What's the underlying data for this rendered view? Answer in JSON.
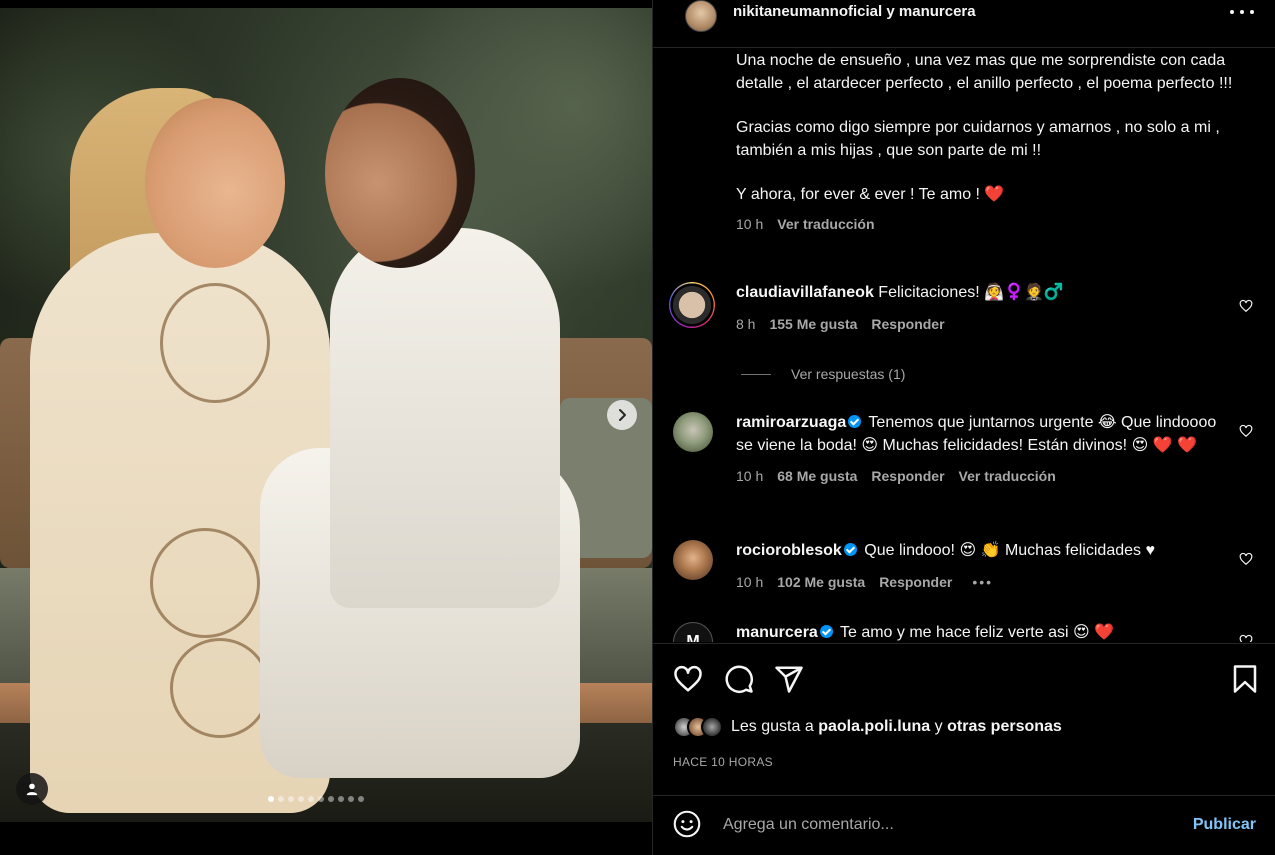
{
  "post": {
    "author": "nikitaneumannoficial",
    "connector": "y",
    "collaborator": "manurcera"
  },
  "caption": {
    "p1": "Una noche de ensueño , una vez mas que me sorprendiste con cada detalle , el atardecer perfecto , el anillo perfecto , el poema perfecto !!!",
    "p2": "Gracias como digo siempre por cuidarnos y amarnos , no solo a mi , también a mis hijas , que son parte de mi !!",
    "p3": "Y ahora, for ever & ever ! Te amo ! ❤️",
    "time": "10 h",
    "translate": "Ver traducción"
  },
  "comments": [
    {
      "user": "claudiavillafaneok",
      "text": "Felicitaciones! 👰♀️🤵♂️",
      "time": "8 h",
      "likes": "155 Me gusta",
      "reply": "Responder",
      "verified": false
    },
    {
      "user": "ramiroarzuaga",
      "text": "Tenemos que juntarnos urgente 😂 Que lindoooo se viene la boda! 😍 Muchas felicidades! Están divinos! 😍 ❤️ ❤️",
      "time": "10 h",
      "likes": "68 Me gusta",
      "reply": "Responder",
      "translate": "Ver traducción",
      "verified": true
    },
    {
      "user": "rocioroblesok",
      "text": "Que lindooo! 😍 👏 Muchas felicidades ♥",
      "time": "10 h",
      "likes": "102 Me gusta",
      "reply": "Responder",
      "verified": true
    },
    {
      "user": "manurcera",
      "text": "Te amo y me hace feliz verte asi 😍 ❤️",
      "verified": true
    }
  ],
  "replies_toggle": "Ver respuestas (1)",
  "likes": {
    "prefix": "Les gusta a",
    "user": "paola.poli.luna",
    "suffix": "y",
    "others": "otras personas"
  },
  "timestamp": "HACE 10 HORAS",
  "add_comment": {
    "placeholder": "Agrega un comentario...",
    "publish": "Publicar"
  },
  "carousel": {
    "slides": 10,
    "current": 1
  },
  "icons": [
    "more-icon",
    "heart-icon",
    "comment-icon",
    "share-icon",
    "bookmark-icon",
    "emoji-icon",
    "chevron-right-icon",
    "user-tag-icon"
  ],
  "colors": {
    "background": "#000000",
    "text": "#f5f5f5",
    "secondary": "#a8a8a8",
    "link": "#81c5f8",
    "verified": "#0095f6",
    "heart": "#ff3040"
  }
}
